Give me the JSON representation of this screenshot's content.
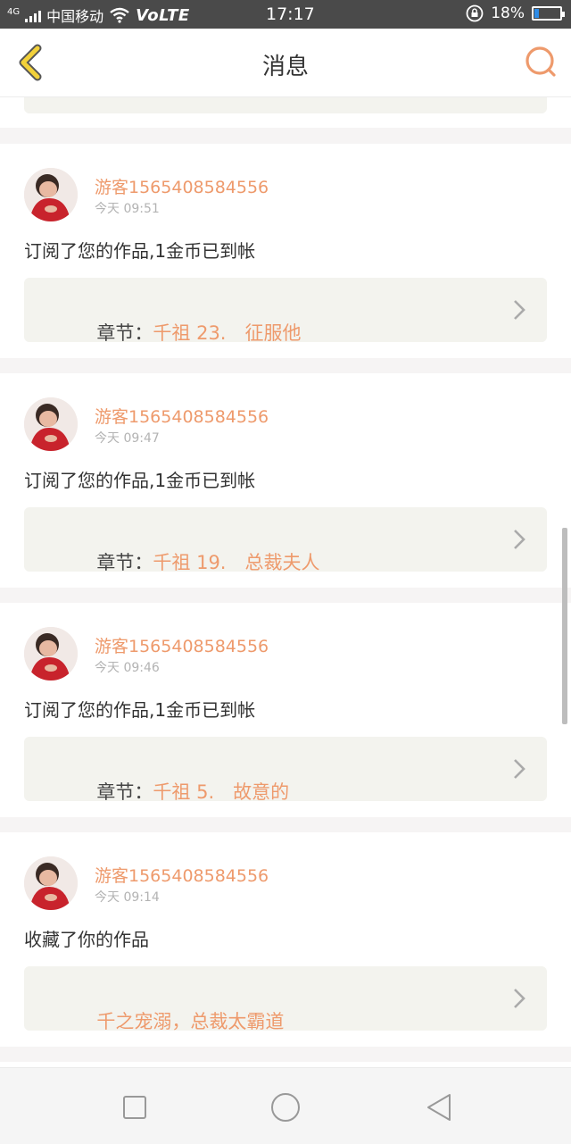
{
  "status_bar": {
    "network": "4G",
    "carrier": "中国移动",
    "volte": "VoLTE",
    "time": "17:17",
    "battery": "18%",
    "battery_level": 0.18
  },
  "header": {
    "title": "消息"
  },
  "messages": [
    {
      "user": "游客1565408584556",
      "time": "今天 09:51",
      "text": "订阅了您的作品,1金币已到帐",
      "chapter_prefix": "章节：",
      "chapter_title": "千祖 23.　征服他"
    },
    {
      "user": "游客1565408584556",
      "time": "今天 09:47",
      "text": "订阅了您的作品,1金币已到帐",
      "chapter_prefix": "章节：",
      "chapter_title": "千祖 19.　总裁夫人"
    },
    {
      "user": "游客1565408584556",
      "time": "今天 09:46",
      "text": "订阅了您的作品,1金币已到帐",
      "chapter_prefix": "章节：",
      "chapter_title": "千祖 5.　故意的"
    },
    {
      "user": "游客1565408584556",
      "time": "今天 09:14",
      "text": "收藏了你的作品",
      "chapter_prefix": "",
      "chapter_title": "千之宠溺，总裁太霸道"
    }
  ],
  "colors": {
    "accent": "#ee9a6c",
    "back_icon": "#f2d13a",
    "status_bar": "#4a4a4a"
  },
  "icons": {
    "back": "chevron-left-icon",
    "search": "search-icon",
    "recent": "square-icon",
    "home": "circle-icon",
    "nav_back": "triangle-back-icon"
  }
}
